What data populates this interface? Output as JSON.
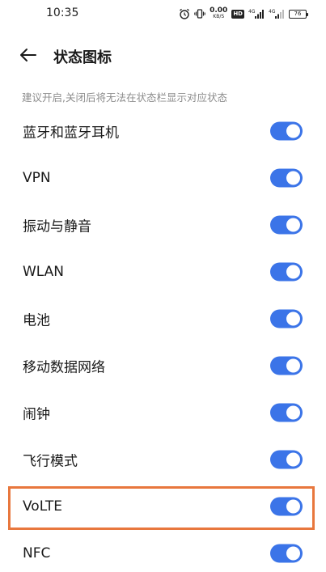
{
  "status_bar": {
    "time": "10:35",
    "speed_value": "0.00",
    "speed_unit": "KB/S",
    "hd_badge": "HD",
    "signal_label_1": "4G",
    "signal_label_2": "4G",
    "battery": "76",
    "icons": [
      "alarm-icon",
      "vibrate-icon",
      "signal-icon",
      "signal-icon",
      "battery-icon"
    ]
  },
  "header": {
    "title": "状态图标",
    "back_icon": "arrow-left-icon"
  },
  "hint": "建议开启,关闭后将无法在状态栏显示对应状态",
  "accent_color": "#3b74e8",
  "highlight_color": "#e8773d",
  "items": [
    {
      "label": "蓝牙和蓝牙耳机",
      "enabled": true
    },
    {
      "label": "VPN",
      "enabled": true
    },
    {
      "label": "振动与静音",
      "enabled": true
    },
    {
      "label": "WLAN",
      "enabled": true
    },
    {
      "label": "电池",
      "enabled": true
    },
    {
      "label": "移动数据网络",
      "enabled": true
    },
    {
      "label": "闹钟",
      "enabled": true
    },
    {
      "label": "飞行模式",
      "enabled": true
    },
    {
      "label": "VoLTE",
      "enabled": true
    },
    {
      "label": "NFC",
      "enabled": true
    }
  ]
}
